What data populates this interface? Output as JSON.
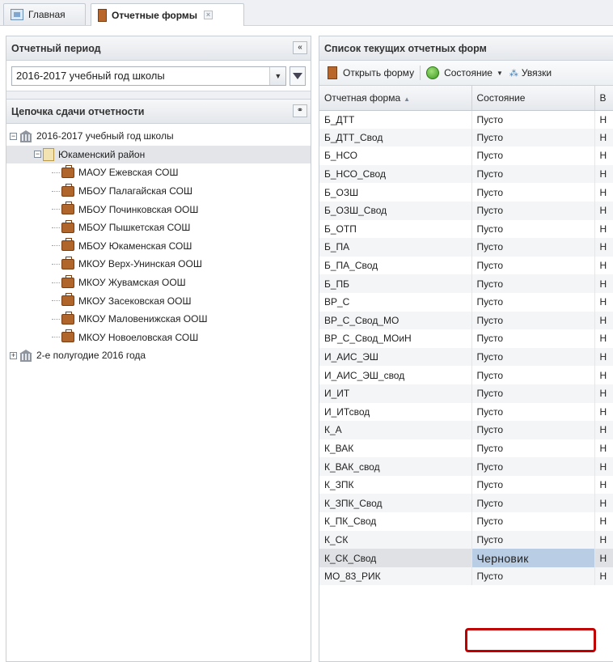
{
  "tabs": [
    {
      "label": "Главная",
      "icon": "home-icon"
    },
    {
      "label": "Отчетные формы",
      "icon": "book-icon",
      "active": true
    }
  ],
  "left": {
    "period_header": "Отчетный период",
    "period_value": "2016-2017 учебный год школы",
    "chain_header": "Цепочка сдачи отчетности",
    "tree": {
      "root": "2016-2017 учебный год школы",
      "district": "Юкаменский район",
      "schools": [
        "МАОУ Ежевская СОШ",
        "МБОУ Палагайская СОШ",
        "МБОУ Починковская ООШ",
        "МБОУ Пышкетская СОШ",
        "МБОУ Юкаменская СОШ",
        "МКОУ Верх-Унинская ООШ",
        "МКОУ Жувамская ООШ",
        "МКОУ Засековская ООШ",
        "МКОУ Маловенижская ООШ",
        "МКОУ Новоеловская СОШ"
      ],
      "second": "2-е полугодие 2016 года"
    }
  },
  "right": {
    "header": "Список текущих отчетных форм",
    "toolbar": {
      "open_label": "Открыть форму",
      "status_label": "Состояние",
      "links_label": "Увязки"
    },
    "columns": [
      "Отчетная форма",
      "Состояние",
      "В"
    ],
    "rows": [
      {
        "form": "Б_ДТТ",
        "state": "Пусто",
        "c3": "Н"
      },
      {
        "form": "Б_ДТТ_Свод",
        "state": "Пусто",
        "c3": "Н"
      },
      {
        "form": "Б_НСО",
        "state": "Пусто",
        "c3": "Н"
      },
      {
        "form": "Б_НСО_Свод",
        "state": "Пусто",
        "c3": "Н"
      },
      {
        "form": "Б_ОЗШ",
        "state": "Пусто",
        "c3": "Н"
      },
      {
        "form": "Б_ОЗШ_Свод",
        "state": "Пусто",
        "c3": "Н"
      },
      {
        "form": "Б_ОТП",
        "state": "Пусто",
        "c3": "Н"
      },
      {
        "form": "Б_ПА",
        "state": "Пусто",
        "c3": "Н"
      },
      {
        "form": "Б_ПА_Свод",
        "state": "Пусто",
        "c3": "Н"
      },
      {
        "form": "Б_ПБ",
        "state": "Пусто",
        "c3": "Н"
      },
      {
        "form": "ВР_С",
        "state": "Пусто",
        "c3": "Н"
      },
      {
        "form": "ВР_С_Свод_МО",
        "state": "Пусто",
        "c3": "Н"
      },
      {
        "form": "ВР_С_Свод_МОиН",
        "state": "Пусто",
        "c3": "Н"
      },
      {
        "form": "И_АИС_ЭШ",
        "state": "Пусто",
        "c3": "Н"
      },
      {
        "form": "И_АИС_ЭШ_свод",
        "state": "Пусто",
        "c3": "Н"
      },
      {
        "form": "И_ИТ",
        "state": "Пусто",
        "c3": "Н"
      },
      {
        "form": "И_ИТсвод",
        "state": "Пусто",
        "c3": "Н"
      },
      {
        "form": "К_А",
        "state": "Пусто",
        "c3": "Н"
      },
      {
        "form": "К_ВАК",
        "state": "Пусто",
        "c3": "Н"
      },
      {
        "form": "К_ВАК_свод",
        "state": "Пусто",
        "c3": "Н"
      },
      {
        "form": "К_ЗПК",
        "state": "Пусто",
        "c3": "Н"
      },
      {
        "form": "К_ЗПК_Свод",
        "state": "Пусто",
        "c3": "Н"
      },
      {
        "form": "К_ПК_Свод",
        "state": "Пусто",
        "c3": "Н"
      },
      {
        "form": "К_СК",
        "state": "Пусто",
        "c3": "Н"
      },
      {
        "form": "К_СК_Свод",
        "state": "Черновик",
        "c3": "Н",
        "selected": true
      },
      {
        "form": "МО_83_РИК",
        "state": "Пусто",
        "c3": "Н"
      }
    ]
  },
  "colors": {
    "highlight": "#c00000",
    "selected_cell": "#b9cde4"
  }
}
